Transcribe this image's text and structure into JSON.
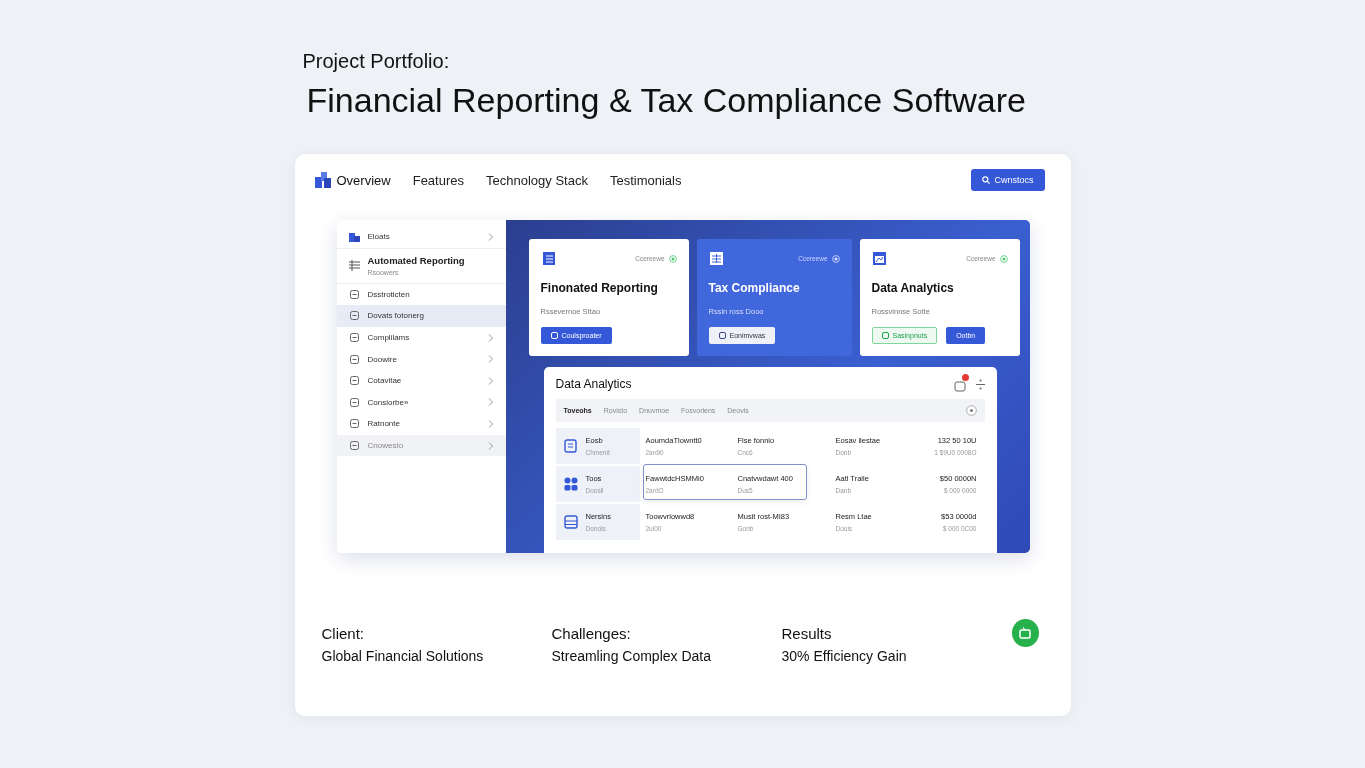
{
  "page": {
    "eyebrow": "Project Portfolio:",
    "title": "Financial Reporting & Tax Compliance Software"
  },
  "nav": {
    "items": [
      {
        "label": "Overview",
        "selected": true
      },
      {
        "label": "Features",
        "selected": false
      },
      {
        "label": "Technology Stack",
        "selected": false
      },
      {
        "label": "Testimonials",
        "selected": false
      }
    ],
    "button": "Cwnstocs"
  },
  "sidebar": {
    "items": [
      {
        "label": "Eloats",
        "selected": false,
        "chevron": true,
        "disabled": false
      },
      {
        "label": "Automated Reporting",
        "sub": "Rsoowers",
        "selected": false,
        "chevron": false,
        "disabled": false
      },
      {
        "label": "Dsstroticten",
        "selected": false,
        "chevron": false,
        "disabled": false
      },
      {
        "label": "Dovats fotonerg",
        "selected": true,
        "chevron": false,
        "disabled": false
      },
      {
        "label": "Complilams",
        "selected": false,
        "chevron": true,
        "disabled": false
      },
      {
        "label": "Doowire",
        "selected": false,
        "chevron": true,
        "disabled": false
      },
      {
        "label": "Cotavitae",
        "selected": false,
        "chevron": true,
        "disabled": false
      },
      {
        "label": "Consiorbe»",
        "selected": false,
        "chevron": true,
        "disabled": false
      },
      {
        "label": "Ratnonte",
        "selected": false,
        "chevron": true,
        "disabled": false
      },
      {
        "label": "Cnowesto",
        "selected": false,
        "chevron": true,
        "disabled": true
      }
    ]
  },
  "cards": [
    {
      "title": "Finonated Reporting",
      "status": "Ccereewe",
      "description": "Rssevernoe Sttao",
      "selected": false,
      "buttons": [
        {
          "label": "Coulsproater",
          "kind": "primary"
        }
      ]
    },
    {
      "title": "Tax Compliance",
      "status": "Ccereewe",
      "description": "Rssin ross Dooo",
      "selected": true,
      "buttons": [
        {
          "label": "Eonimvwas",
          "kind": "light"
        }
      ]
    },
    {
      "title": "Data Analytics",
      "status": "Ccereewe",
      "description": "Rossvinnse Sotte",
      "selected": false,
      "buttons": [
        {
          "label": "Sasinpnuts",
          "kind": "success"
        },
        {
          "label": "Ootbn",
          "kind": "primary"
        }
      ]
    }
  ],
  "analytics": {
    "title": "Data Analytics",
    "tabs": [
      {
        "label": "Toveohs",
        "selected": true
      },
      {
        "label": "Rovisto",
        "selected": false
      },
      {
        "label": "Dnuvmoe",
        "selected": false
      },
      {
        "label": "Fosvorlens",
        "selected": false
      },
      {
        "label": "Deovis",
        "selected": false
      }
    ],
    "rows": [
      {
        "name": "Eosb",
        "name_sub": "Chmenit",
        "highlighted": false,
        "cells": [
          {
            "text": "AoumdaTlowntt0",
            "sub": "2ardi0"
          },
          {
            "text": "Flse fonnio",
            "sub": "Cnc6"
          },
          {
            "text": "Eosav ilestae",
            "sub": "Donb"
          },
          {
            "text": "132 50 10U",
            "sub": "1 $9U0 0008O"
          }
        ]
      },
      {
        "name": "Toos",
        "name_sub": "Doosli",
        "highlighted": true,
        "cells": [
          {
            "text": "FawwtdcHSMMi0",
            "sub": "2ardO"
          },
          {
            "text": "Cnatvwdawt 400",
            "sub": "Dus5"
          },
          {
            "text": "Aatl Traile",
            "sub": "Danb"
          },
          {
            "text": "$50 0000N",
            "sub": "$ 000 0000"
          }
        ]
      },
      {
        "name": "Nersins",
        "name_sub": "Donols",
        "highlighted": false,
        "cells": [
          {
            "text": "Toowvrlowwd8",
            "sub": "2ui00"
          },
          {
            "text": "Musit rost-MI83",
            "sub": "Gonb"
          },
          {
            "text": "Resm Ltae",
            "sub": "Douis"
          },
          {
            "text": "$53 0000d",
            "sub": "$ 000 0C00"
          }
        ]
      }
    ]
  },
  "summary": [
    {
      "label": "Client:",
      "value": "Global Financial Solutions"
    },
    {
      "label": "Challenges:",
      "value": "Streamling Complex Data"
    },
    {
      "label": "Results",
      "value": "30% Efficiency Gain"
    }
  ]
}
